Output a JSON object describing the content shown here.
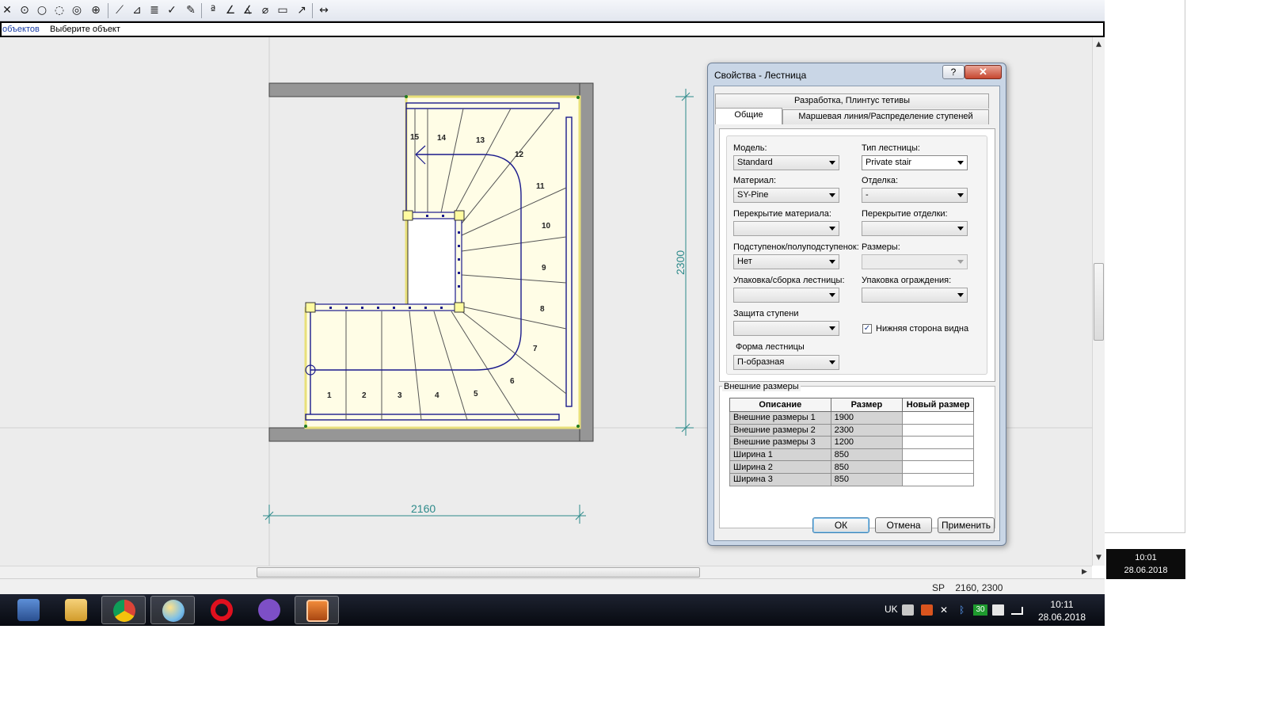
{
  "toolbar": {
    "icons": [
      "line-icon",
      "point-icon",
      "circle-icon",
      "arc-icon",
      "circle-3pt-icon",
      "align-icon",
      "draw-icon",
      "edit-icon",
      "layers-icon",
      "check-icon",
      "pen-icon",
      "text-icon",
      "angle-icon",
      "angle2-icon",
      "diameter-icon",
      "rect-icon",
      "dimension-icon",
      "measure-icon"
    ]
  },
  "command": {
    "prefix": "объектов",
    "prompt": "Выберите объект"
  },
  "drawing": {
    "dimension_bottom": "2160",
    "dimension_right": "2300",
    "step_numbers": [
      "1",
      "2",
      "3",
      "4",
      "5",
      "6",
      "7",
      "8",
      "9",
      "10",
      "11",
      "12",
      "13",
      "14",
      "15"
    ]
  },
  "status": {
    "prefix": "SP",
    "coords": "2160,   2300"
  },
  "clock_secondary": {
    "time": "10:01",
    "date": "28.06.2018"
  },
  "taskbar": {
    "apps": [
      "media-player",
      "file-explorer",
      "chrome",
      "paint",
      "opera",
      "viber",
      "stair-designer"
    ],
    "tray": {
      "lang": "UK",
      "badge": "30",
      "time": "10:11",
      "date": "28.06.2018"
    }
  },
  "dialog": {
    "title": "Свойства - Лестница",
    "help_label": "?",
    "close_label": "✕",
    "tabs_top": [
      "Разработка, Плинтус тетивы"
    ],
    "tabs_bottom": [
      "Общие",
      "Маршевая линия/Распределение ступеней"
    ],
    "fields": {
      "model": {
        "label": "Модель:",
        "value": "Standard"
      },
      "stair_type": {
        "label": "Тип лестницы:",
        "value": "Private stair"
      },
      "material": {
        "label": "Материал:",
        "value": "SY-Pine"
      },
      "finish": {
        "label": "Отделка:",
        "value": "-"
      },
      "material_overlay": {
        "label": "Перекрытие материала:",
        "value": ""
      },
      "finish_overlay": {
        "label": "Перекрытие отделки:",
        "value": ""
      },
      "riser": {
        "label": "Подступенок/полуподступенок:",
        "value": "Нет"
      },
      "sizes": {
        "label": "Размеры:",
        "value": ""
      },
      "stair_packing": {
        "label": "Упаковка/сборка лестницы:",
        "value": ""
      },
      "rail_packing": {
        "label": "Упаковка ограждения:",
        "value": ""
      },
      "step_protection": {
        "label": "Защита ступени",
        "value": ""
      },
      "underside_visible": {
        "label": "Нижняя сторона видна",
        "checked": true
      },
      "stair_shape": {
        "label": "Форма лестницы",
        "value": "П-образная"
      }
    },
    "external_sizes": {
      "title": "Внешние размеры",
      "columns": [
        "Описание",
        "Размер",
        "Новый размер"
      ],
      "rows": [
        [
          "Внешние размеры 1",
          "1900",
          ""
        ],
        [
          "Внешние размеры 2",
          "2300",
          ""
        ],
        [
          "Внешние размеры 3",
          "1200",
          ""
        ],
        [
          "Ширина 1",
          "850",
          ""
        ],
        [
          "Ширина 2",
          "850",
          ""
        ],
        [
          "Ширина 3",
          "850",
          ""
        ]
      ]
    },
    "buttons": {
      "ok": "ОК",
      "cancel": "Отмена",
      "apply": "Применить"
    }
  },
  "colors": {
    "stair_line": "#1a1a8c",
    "wall": "#969696",
    "stair_fill": "#fffde6",
    "dimension": "#2d8a8a",
    "dialog_frame": "#c9d6e6"
  }
}
